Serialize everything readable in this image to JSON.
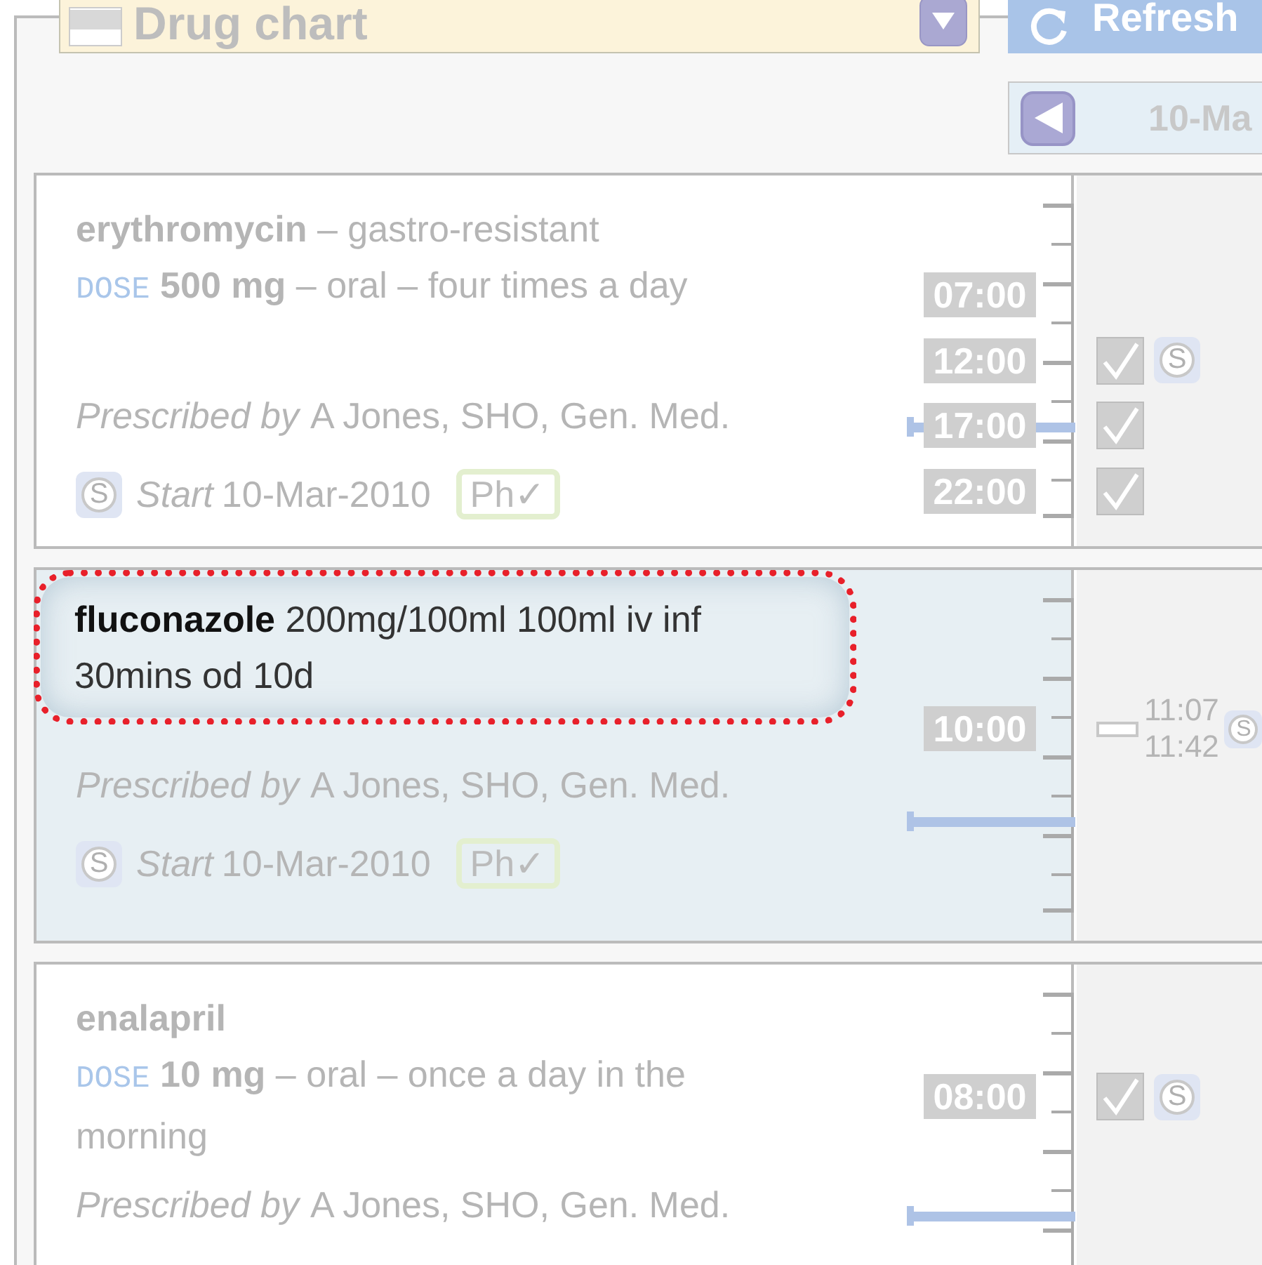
{
  "header": {
    "chart_select": {
      "value": "Drug chart"
    },
    "refresh_button": {
      "label": "Refresh"
    },
    "date_nav": {
      "date": "10-Ma"
    }
  },
  "medications": [
    {
      "kind": "structured",
      "selected": false,
      "highlighted": false,
      "description": "**erythromycin** – gastro-resistant",
      "dose_label": "DOSE",
      "dose_text": "**500 mg** – oral – four times a day",
      "prescribed_label": "Prescribed by",
      "prescriber": "A Jones, SHO, Gen. Med.",
      "start": {
        "signed_mark": "S",
        "label": "Start",
        "date": "10-Mar-2010",
        "pharmacy_badge": "Ph✓"
      },
      "doses": [
        {
          "time": "07:00",
          "kind": "pending"
        },
        {
          "time": "12:00",
          "kind": "given",
          "signed_mark": "S"
        },
        {
          "time": "17:00",
          "kind": "given"
        },
        {
          "time": "22:00",
          "kind": "given"
        }
      ]
    },
    {
      "kind": "free_text",
      "selected": true,
      "highlighted": true,
      "description": "**fluconazole** 200mg/100ml 100ml iv inf 30mins od 10d",
      "prescribed_label": "Prescribed by",
      "prescriber": "A Jones, SHO, Gen. Med.",
      "start": {
        "signed_mark": "S",
        "label": "Start",
        "date": "10-Mar-2010",
        "pharmacy_badge": "Ph✓"
      },
      "doses": [
        {
          "time": "10:00",
          "kind": "infusion",
          "start_time": "11:07",
          "end_time": "11:42",
          "signed_mark": "S"
        }
      ]
    },
    {
      "kind": "structured",
      "selected": false,
      "highlighted": false,
      "description": "**enalapril**",
      "dose_label": "DOSE",
      "dose_text": "**10 mg** – oral – once a day in the morning",
      "prescribed_label": "Prescribed by",
      "prescriber": "A Jones, SHO, Gen. Med.",
      "doses": [
        {
          "time": "08:00",
          "kind": "given",
          "signed_mark": "S"
        }
      ]
    }
  ]
}
